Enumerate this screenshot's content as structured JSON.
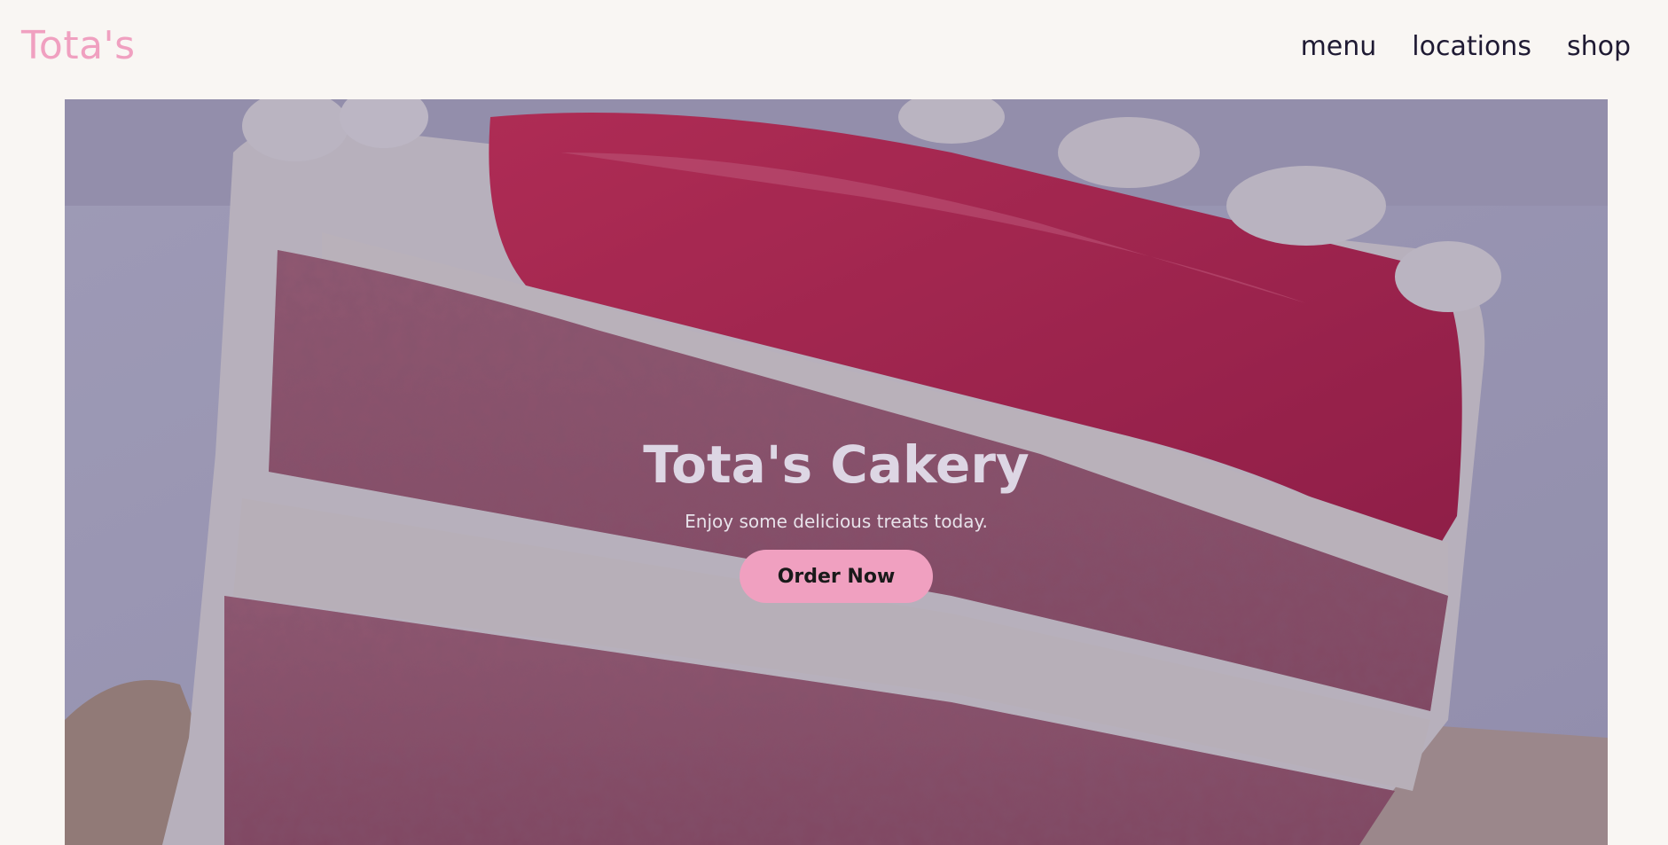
{
  "header": {
    "logo": "Tota's",
    "nav": [
      "menu",
      "locations",
      "shop"
    ]
  },
  "hero": {
    "title": "Tota's Cakery",
    "subtitle": "Enjoy some delicious treats today.",
    "cta_label": "Order Now"
  },
  "colors": {
    "accent": "#f0a0c0",
    "background": "#f9f6f3",
    "nav_text": "#1f1a33"
  }
}
